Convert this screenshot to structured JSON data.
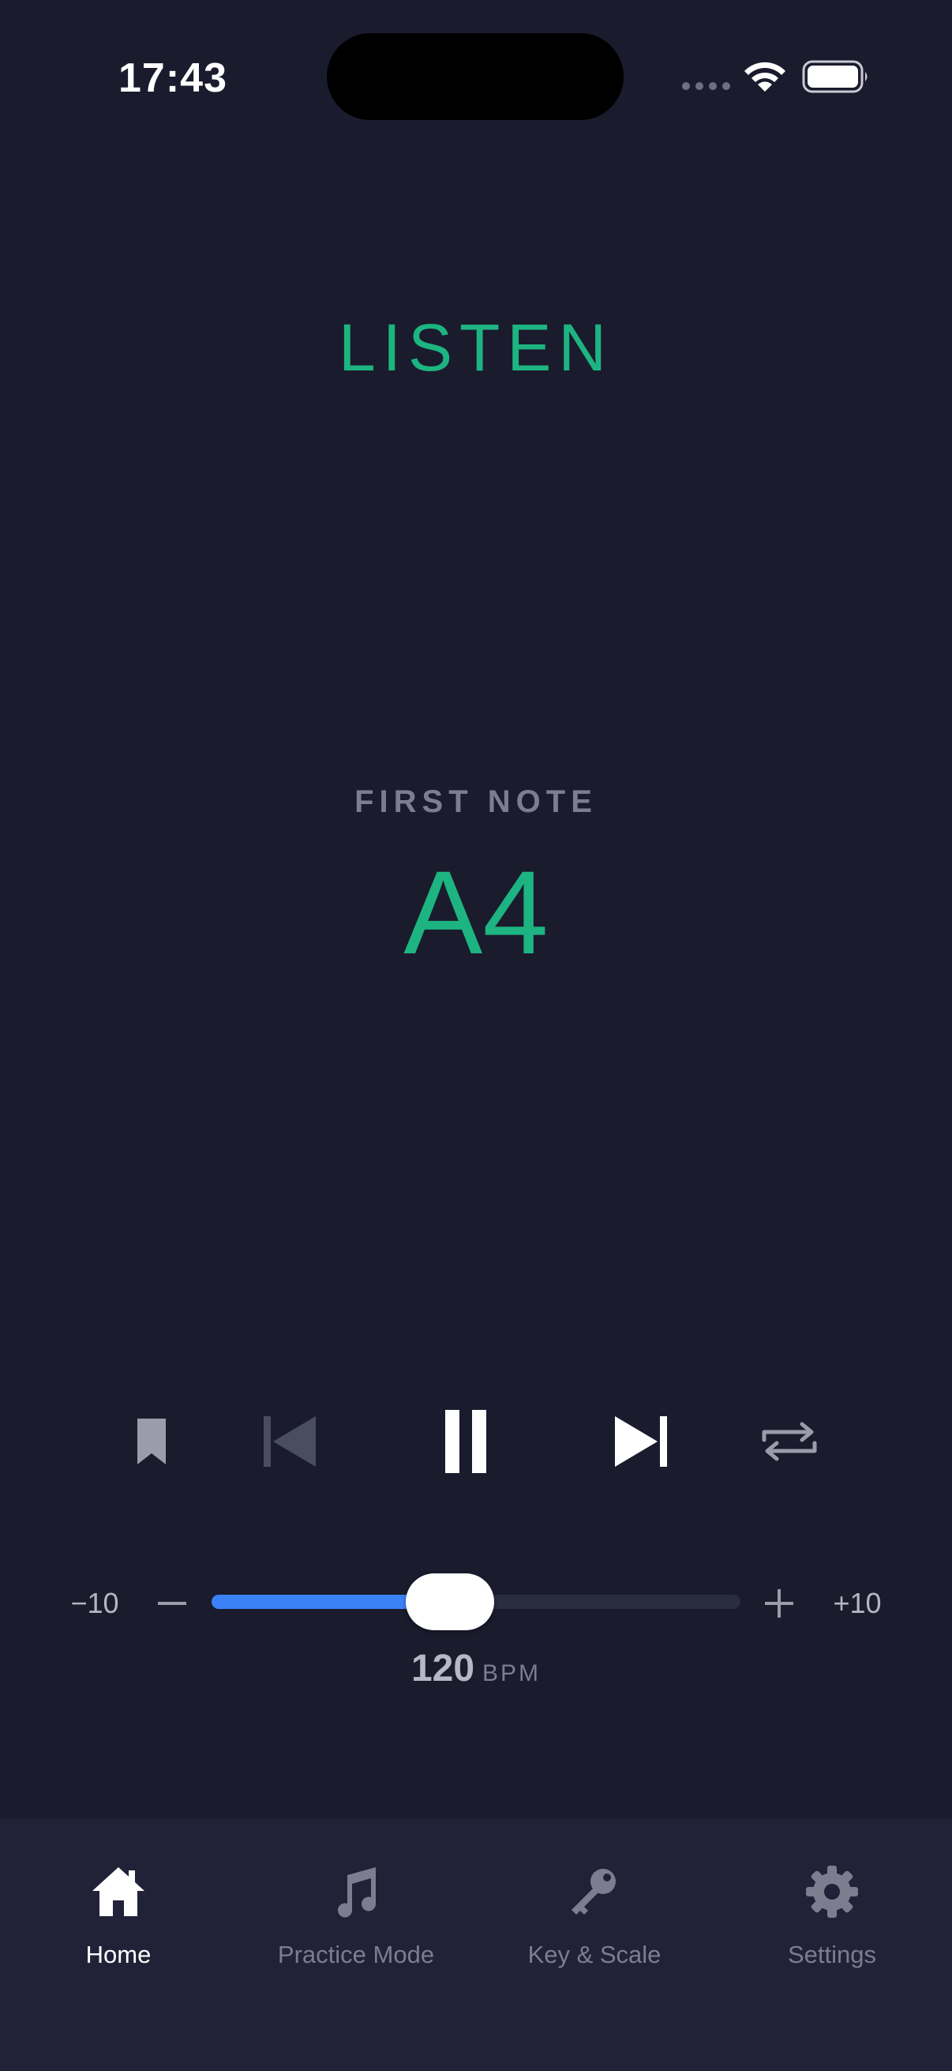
{
  "status_bar": {
    "time": "17:43"
  },
  "mode_title": "LISTEN",
  "first_note": {
    "label": "FIRST NOTE",
    "value": "A4"
  },
  "controls": {
    "bookmark_icon": "bookmark-icon",
    "previous_icon": "skip-previous-icon",
    "pause_icon": "pause-icon",
    "next_icon": "skip-next-icon",
    "repeat_icon": "repeat-icon"
  },
  "tempo": {
    "min_label": "−10",
    "max_label": "+10",
    "level_fraction": 0.45,
    "bpm_value": "120",
    "bpm_unit": "BPM"
  },
  "tabs": [
    {
      "label": "Home",
      "icon": "house-icon",
      "active": true
    },
    {
      "label": "Practice Mode",
      "icon": "music-note-icon",
      "active": false
    },
    {
      "label": "Key & Scale",
      "icon": "key-icon",
      "active": false
    },
    {
      "label": "Settings",
      "icon": "gear-icon",
      "active": false
    }
  ],
  "colors": {
    "background": "#1a1b2d",
    "accent_green": "#1db481",
    "accent_blue": "#3b82f6",
    "tab_bar": "#212238",
    "muted_text": "#7c7d8e"
  }
}
